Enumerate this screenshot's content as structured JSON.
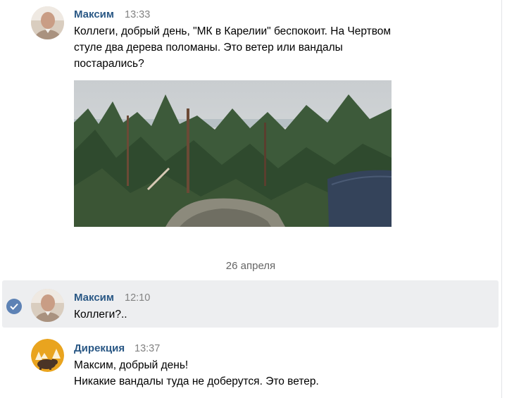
{
  "messages": [
    {
      "author": "Максим",
      "time": "13:33",
      "lines": [
        "Коллеги, добрый день, \"МК в Карелии\" беспокоит. На Чертвом",
        "стуле два дерева поломаны. Это ветер или вандалы",
        "постарались?"
      ],
      "photo": {
        "icon": "forest-photo"
      }
    },
    {
      "author": "Максим",
      "time": "12:10",
      "lines": [
        "Коллеги?.."
      ],
      "selected": true
    },
    {
      "author": "Дирекция",
      "time": "13:37",
      "lines": [
        "Максим, добрый день!",
        "Никакие вандалы туда не доберутся. Это ветер."
      ],
      "avatar_icon": "bear-logo"
    }
  ],
  "date_separator": "26 апреля",
  "colors": {
    "author": "#2a5885",
    "time": "#828282",
    "selected_bg": "#edeef0",
    "check": "#5d82b5",
    "bear_logo_bg": "#e9a41f"
  }
}
